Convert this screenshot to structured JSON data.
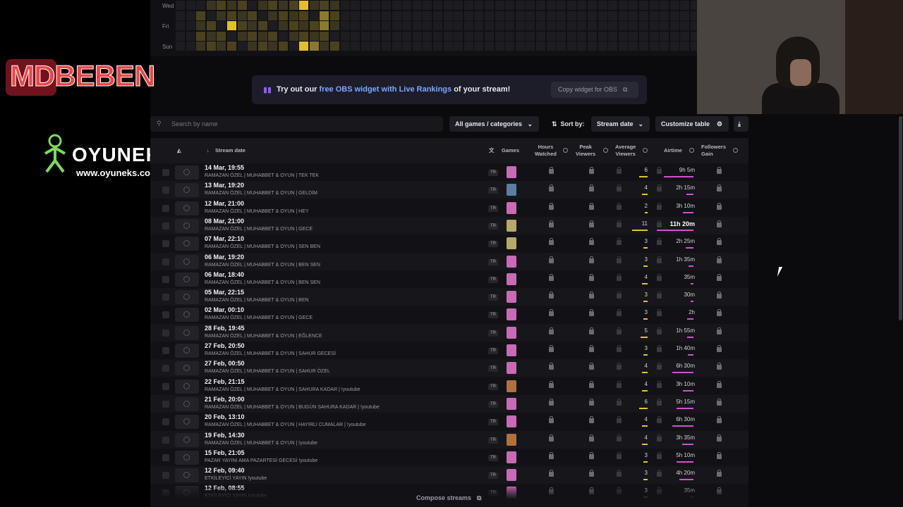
{
  "heatmap": {
    "day_labels": [
      "Wed",
      "Fri",
      "Sun"
    ]
  },
  "overlays": {
    "logo_text": "MDBEBEN",
    "oyuneks_name": "OYUNEKS",
    "oyuneks_url": "www.oyuneks.com"
  },
  "banner": {
    "text_before": "Try out our ",
    "text_link": "free OBS widget with Live Rankings",
    "text_after": " of your stream!",
    "copy_button": "Copy widget for OBS"
  },
  "toolbar": {
    "search_placeholder": "Search by name",
    "games_filter": "All games / categories",
    "sort_label": "Sort by:",
    "sort_value": "Stream date",
    "customize": "Customize table"
  },
  "table": {
    "headers": {
      "stream_date": "Stream date",
      "games": "Games",
      "hours_watched_1": "Hours",
      "hours_watched_2": "Watched",
      "peak_viewers_1": "Peak",
      "peak_viewers_2": "Viewers",
      "avg_viewers_1": "Average",
      "avg_viewers_2": "Viewers",
      "airtime": "Airtime",
      "followers_1": "Followers",
      "followers_2": "Gain"
    },
    "rows": [
      {
        "date": "14 Mar, 19:55",
        "title": "RAMAZAN ÖZEL | MUHABBET & OYUN | TEK TEK",
        "lang": "TR",
        "avg": "6",
        "airtime": "9h 5m",
        "game": "#c96ab5"
      },
      {
        "date": "13 Mar, 19:20",
        "title": "RAMAZAN ÖZEL | MUHABBET & OYUN | GELDİM",
        "lang": "TR",
        "avg": "4",
        "airtime": "2h 15m",
        "game": "#5a7fa0"
      },
      {
        "date": "12 Mar, 21:00",
        "title": "RAMAZAN ÖZEL | MUHABBET & OYUN | HEY",
        "lang": "TR",
        "avg": "2",
        "airtime": "3h 10m",
        "game": "#c96ab5"
      },
      {
        "date": "08 Mar, 21:00",
        "title": "RAMAZAN ÖZEL | MUHABBET & OYUN | GECE",
        "lang": "TR",
        "avg": "11",
        "airtime": "11h 20m",
        "game": "#b8a86a"
      },
      {
        "date": "07 Mar, 22:10",
        "title": "RAMAZAN ÖZEL | MUHABBET & OYUN | SEN BEN",
        "lang": "TR",
        "avg": "3",
        "airtime": "2h 25m",
        "game": "#b8a86a"
      },
      {
        "date": "06 Mar, 19:20",
        "title": "RAMAZAN ÖZEL | MUHABBET & OYUN | BEN SEN",
        "lang": "TR",
        "avg": "3",
        "airtime": "1h 35m",
        "game": "#c96ab5"
      },
      {
        "date": "06 Mar, 18:40",
        "title": "RAMAZAN ÖZEL | MUHABBET & OYUN | BEN SEN",
        "lang": "TR",
        "avg": "4",
        "airtime": "35m",
        "game": "#c96ab5"
      },
      {
        "date": "05 Mar, 22:15",
        "title": "RAMAZAN ÖZEL | MUHABBET & OYUN | BEN",
        "lang": "TR",
        "avg": "3",
        "airtime": "30m",
        "game": "#c96ab5"
      },
      {
        "date": "02 Mar, 00:10",
        "title": "RAMAZAN ÖZEL | MUHABBET & OYUN | GECE",
        "lang": "TR",
        "avg": "3",
        "airtime": "2h",
        "game": "#c96ab5"
      },
      {
        "date": "28 Feb, 19:45",
        "title": "RAMAZAN ÖZEL | MUHABBET & OYUN | EĞLENCE",
        "lang": "TR",
        "avg": "5",
        "airtime": "1h 55m",
        "game": "#c96ab5"
      },
      {
        "date": "27 Feb, 20:50",
        "title": "RAMAZAN ÖZEL | MUHABBET & OYUN | SAHUR GECESİ",
        "lang": "TR",
        "avg": "3",
        "airtime": "1h 40m",
        "game": "#c96ab5"
      },
      {
        "date": "27 Feb, 00:50",
        "title": "RAMAZAN ÖZEL | MUHABBET & OYUN | SAHUR ÖZEL",
        "lang": "TR",
        "avg": "4",
        "airtime": "6h 30m",
        "game": "#c96ab5"
      },
      {
        "date": "22 Feb, 21:15",
        "title": "RAMAZAN ÖZEL | MUHABBET & OYUN | SAHURA KADAR | !youtube",
        "lang": "TR",
        "avg": "4",
        "airtime": "3h 10m",
        "game": "#b07040"
      },
      {
        "date": "21 Feb, 20:00",
        "title": "RAMAZAN ÖZEL | MUHABBET & OYUN | BUGÜN SAHURA KADAR | !youtube",
        "lang": "TR",
        "avg": "6",
        "airtime": "5h 15m",
        "game": "#c96ab5"
      },
      {
        "date": "20 Feb, 13:10",
        "title": "RAMAZAN ÖZEL | MUHABBET & OYUN | HAYIRLI CUMALAR | !youtube",
        "lang": "TR",
        "avg": "4",
        "airtime": "6h 30m",
        "game": "#c96ab5"
      },
      {
        "date": "19 Feb, 14:30",
        "title": "RAMAZAN ÖZEL | MUHABBET & OYUN | !youtube",
        "lang": "TR",
        "avg": "4",
        "airtime": "3h 35m",
        "game": "#b07040"
      },
      {
        "date": "15 Feb, 21:05",
        "title": "PAZAR YAYINI AMA PAZARTESİ GECESİ !youtube",
        "lang": "TR",
        "avg": "3",
        "airtime": "5h 10m",
        "game": "#c96ab5"
      },
      {
        "date": "12 Feb, 09:40",
        "title": "ETKİLEYİCİ YAYIN !youtube",
        "lang": "TR",
        "avg": "3",
        "airtime": "4h 20m",
        "game": "#c96ab5"
      },
      {
        "date": "12 Feb, 08:55",
        "title": "ETKİLEYİCİ YAYIN !youtube",
        "lang": "TR",
        "avg": "3",
        "airtime": "35m",
        "game": "#c96ab5"
      }
    ],
    "compose_label": "Compose streams"
  },
  "colors": {
    "accent_purple": "#8b5cf6",
    "link_blue": "#7aa7ff",
    "avg_bar": "#e6c32a",
    "airtime_bar": "#d34fd1"
  }
}
